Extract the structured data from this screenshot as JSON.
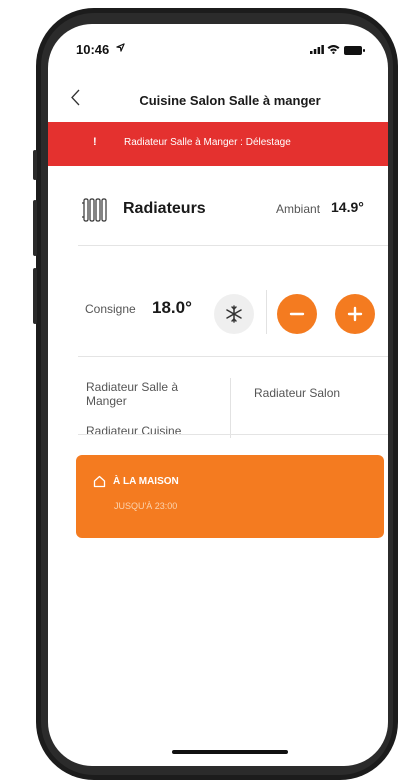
{
  "status_bar": {
    "time": "10:46"
  },
  "nav": {
    "title": "Cuisine Salon Salle à manger"
  },
  "alert": {
    "icon": "!",
    "text": "Radiateur Salle à Manger : Délestage",
    "color": "#e4312f"
  },
  "radiators": {
    "title": "Radiateurs",
    "ambient_label": "Ambiant",
    "ambient_value": "14.9°"
  },
  "setpoint": {
    "label": "Consigne",
    "value": "18.0°",
    "mode_icon": "snowflake-icon",
    "minus_icon": "minus-icon",
    "plus_icon": "plus-icon"
  },
  "rooms": [
    {
      "name": "Radiateur Salle à Manger"
    },
    {
      "name": "Radiateur Cuisine"
    },
    {
      "name": "Radiateur Salon"
    }
  ],
  "mode": {
    "icon": "home-icon",
    "title": "À LA MAISON",
    "subtitle": "JUSQU'À 23:00",
    "color": "#f47b20"
  }
}
